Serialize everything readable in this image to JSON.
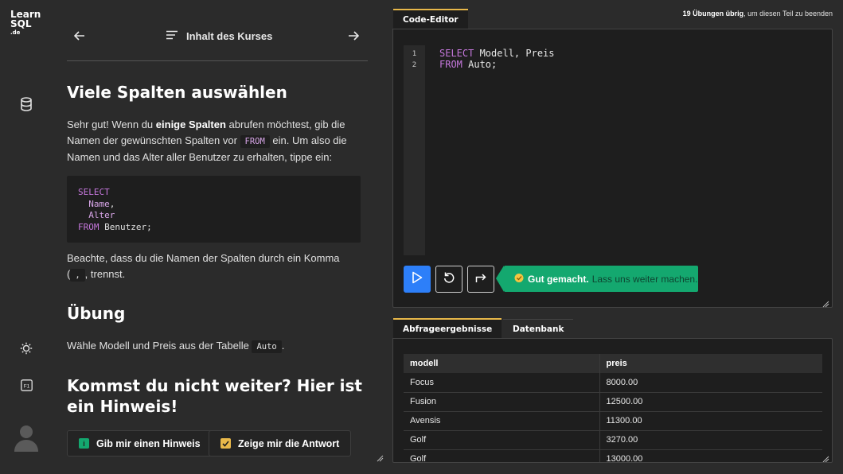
{
  "logo": {
    "line1": "Learn",
    "line2": "SQL",
    "tld": ".de"
  },
  "nav": {
    "course_label": "Inhalt des Kurses",
    "prev_icon": "arrow-left-icon",
    "next_icon": "arrow-right-icon",
    "menu_icon": "list-icon"
  },
  "rail": {
    "icons": [
      "database-icon",
      "sun-icon",
      "keyboard-shortcut-icon",
      "avatar"
    ],
    "shortcut_label": "F1"
  },
  "lesson": {
    "title": "Viele Spalten auswählen",
    "p1_a": "Sehr gut! Wenn du ",
    "p1_b": "einige Spalten",
    "p1_c": " abrufen möchtest, gib die Namen der gewünschten Spalten vor ",
    "p1_code": "FROM",
    "p1_d": " ein. Um also die Namen und das Alter aller Benutzer zu erhalten, tippe ein:",
    "code_lines": {
      "l1": "SELECT",
      "l2": "Name",
      "l2_sep": ",",
      "l3": "Alter",
      "l4_kw": "FROM",
      "l4_rest": " Benutzer;"
    },
    "p2_a": "Beachte, dass du die Namen der Spalten durch ein Komma",
    "p2_code": ",",
    "p2_b": ", trennst.",
    "exercise_title": "Übung",
    "exercise_a": "Wähle Modell und Preis aus der Tabelle ",
    "exercise_code": "Auto",
    "exercise_b": ".",
    "hint_title": "Kommst du nicht weiter? Hier ist ein Hinweis!",
    "hint_button": "Gib mir einen Hinweis",
    "answer_button": "Zeige mir die Antwort"
  },
  "remaining": {
    "bold": "19 Übungen übrig",
    "rest": ", um diesen Teil zu beenden"
  },
  "editor": {
    "tab_label": "Code-Editor",
    "line_numbers": [
      "1",
      "2"
    ],
    "line1_kw": "SELECT",
    "line1_rest": " Modell, Preis",
    "line2_kw": "FROM",
    "line2_rest": " Auto;",
    "run_icon": "play-icon",
    "reset_icon": "reset-icon",
    "next_icon": "redo-icon",
    "toast_bold": "Gut gemacht.",
    "toast_rest": "Lass uns weiter machen."
  },
  "results": {
    "tab_results": "Abfrageergebnisse",
    "tab_database": "Datenbank",
    "columns": [
      "modell",
      "preis"
    ],
    "rows": [
      [
        "Focus",
        "8000.00"
      ],
      [
        "Fusion",
        "12500.00"
      ],
      [
        "Avensis",
        "11300.00"
      ],
      [
        "Golf",
        "3270.00"
      ],
      [
        "Golf",
        "13000.00"
      ]
    ]
  },
  "colors": {
    "accent_tab": "#e8b84a",
    "run_button": "#2d7ff9",
    "success": "#14a86f",
    "keyword": "#c678dd"
  }
}
